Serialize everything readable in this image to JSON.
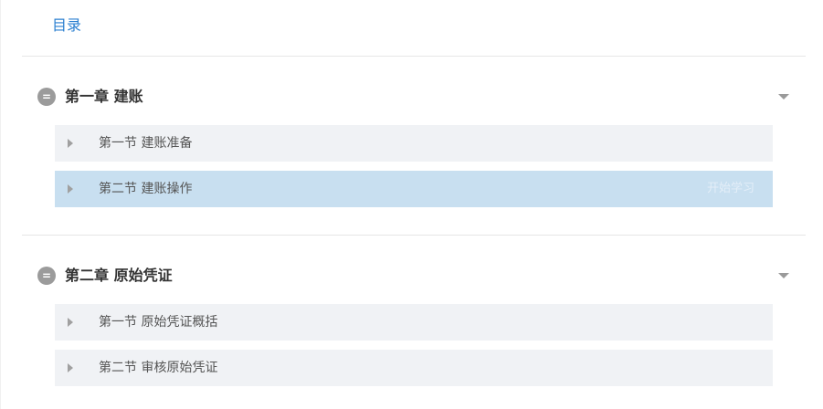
{
  "toc": {
    "title": "目录"
  },
  "chapters": [
    {
      "badge": "=",
      "title": "第一章 建账",
      "sections": [
        {
          "title": "第一节 建账准备",
          "action": ""
        },
        {
          "title": "第二节 建账操作",
          "action": "开始学习"
        }
      ]
    },
    {
      "badge": "=",
      "title": "第二章 原始凭证",
      "sections": [
        {
          "title": "第一节 原始凭证概括",
          "action": ""
        },
        {
          "title": "第二节 审核原始凭证",
          "action": ""
        }
      ]
    }
  ]
}
